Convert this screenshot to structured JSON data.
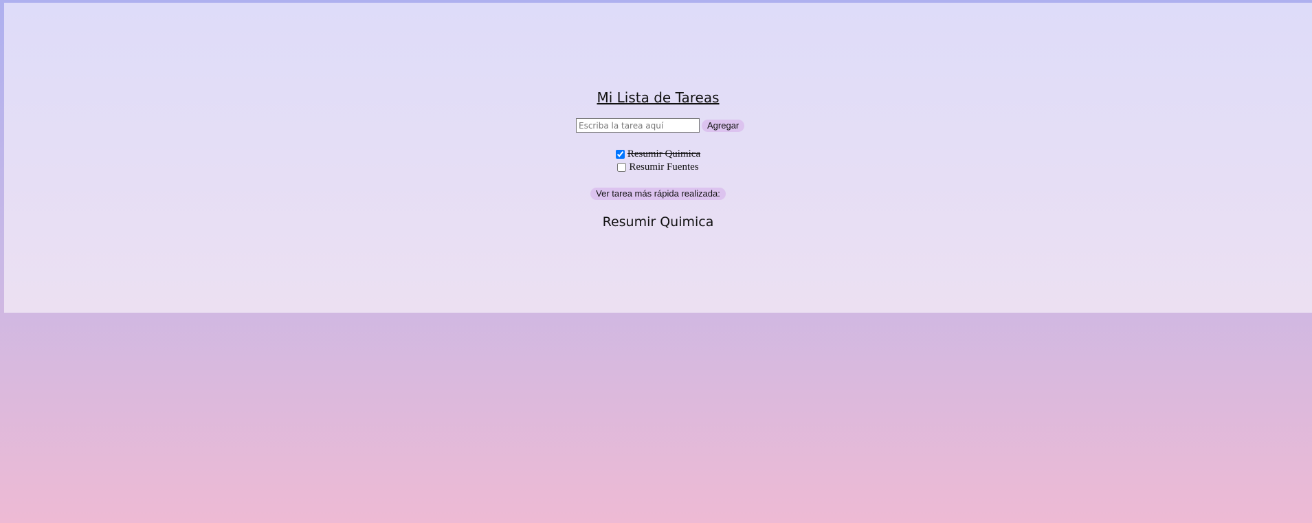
{
  "app": {
    "title": "Mi Lista de Tareas"
  },
  "form": {
    "input_placeholder": "Escriba la tarea aquí",
    "input_value": "",
    "add_button_label": "Agregar"
  },
  "tasks": [
    {
      "label": "Resumir Quimica",
      "checked": true
    },
    {
      "label": "Resumir Fuentes",
      "checked": false
    }
  ],
  "fastest": {
    "button_label": "Ver tarea más rápida realizada:",
    "result": "Resumir Quimica"
  },
  "colors": {
    "button_bg": "#dcc3ef",
    "panel_top": "#dedcf9",
    "panel_bottom": "#ece0f2",
    "page_bottom": "#eebad4"
  }
}
